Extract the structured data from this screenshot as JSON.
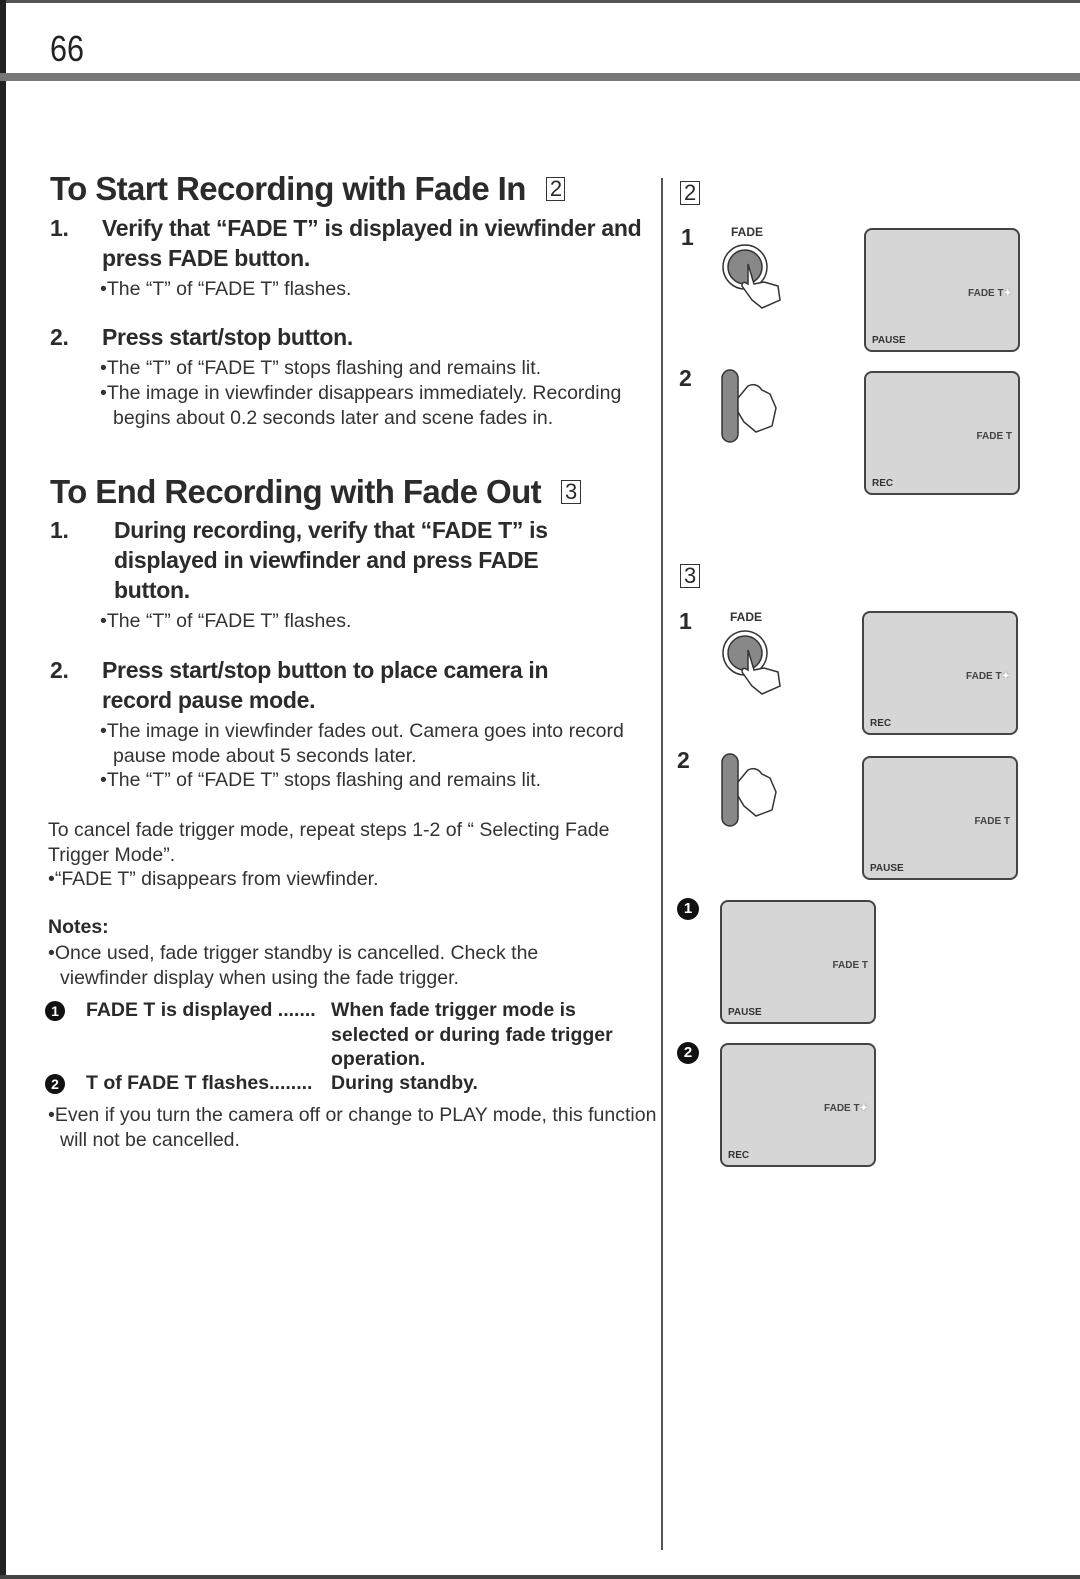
{
  "page_number": "66",
  "section_fade_in": {
    "title": "To Start Recording with Fade In",
    "figure_ref": "2",
    "steps": [
      {
        "num": "1.",
        "text": "Verify that “FADE T” is displayed in viewfinder and press FADE button.",
        "bullets": [
          "The “T” of “FADE T” flashes."
        ]
      },
      {
        "num": "2.",
        "text": "Press start/stop button.",
        "bullets": [
          "The “T” of “FADE T” stops flashing and remains lit.",
          "The image in viewfinder disappears immediately. Recording begins about 0.2 seconds later and scene fades in."
        ]
      }
    ]
  },
  "section_fade_out": {
    "title": "To End Recording with Fade Out",
    "figure_ref": "3",
    "steps": [
      {
        "num": "1.",
        "text": "During recording, verify that “FADE T” is displayed in viewfinder and press FADE button.",
        "bullets": [
          "The “T” of “FADE T” flashes."
        ]
      },
      {
        "num": "2.",
        "text": "Press start/stop button to place camera in record pause mode.",
        "bullets": [
          "The image in viewfinder fades out. Camera goes into record pause mode about 5 seconds later.",
          "The “T” of “FADE T” stops flashing and remains lit."
        ]
      }
    ]
  },
  "cancel": {
    "text": "To cancel fade trigger mode, repeat steps 1-2 of “ Selecting Fade Trigger Mode”.",
    "bullet": "“FADE T” disappears from viewfinder."
  },
  "notes": {
    "title": "Notes:",
    "bullet1": "Once used, fade trigger standby is cancelled. Check the viewfinder display when using the fade trigger.",
    "rows": [
      {
        "marker": "1",
        "label": "FADE T is displayed .......",
        "desc": "When fade trigger mode is selected or during fade trigger operation."
      },
      {
        "marker": "2",
        "label": "T of FADE T flashes........",
        "desc": "During standby."
      }
    ],
    "bullet2": "Even if you turn the camera off or change to PLAY mode, this function will not be cancelled."
  },
  "figures": {
    "fig2": {
      "ref": "2",
      "step1": {
        "num": "1",
        "button_label": "FADE",
        "screen_status": "PAUSE",
        "screen_fade": "FADE T",
        "flashing": true
      },
      "step2": {
        "num": "2",
        "screen_status": "REC",
        "screen_fade": "FADE T",
        "flashing": false
      }
    },
    "fig3": {
      "ref": "3",
      "step1": {
        "num": "1",
        "button_label": "FADE",
        "screen_status": "REC",
        "screen_fade": "FADE T",
        "flashing": true
      },
      "step2": {
        "num": "2",
        "screen_status": "PAUSE",
        "screen_fade": "FADE T",
        "flashing": false
      }
    },
    "marker1": {
      "marker": "1",
      "screen_status": "PAUSE",
      "screen_fade": "FADE T"
    },
    "marker2": {
      "marker": "2",
      "screen_status": "REC",
      "screen_fade": "FADE T"
    }
  }
}
